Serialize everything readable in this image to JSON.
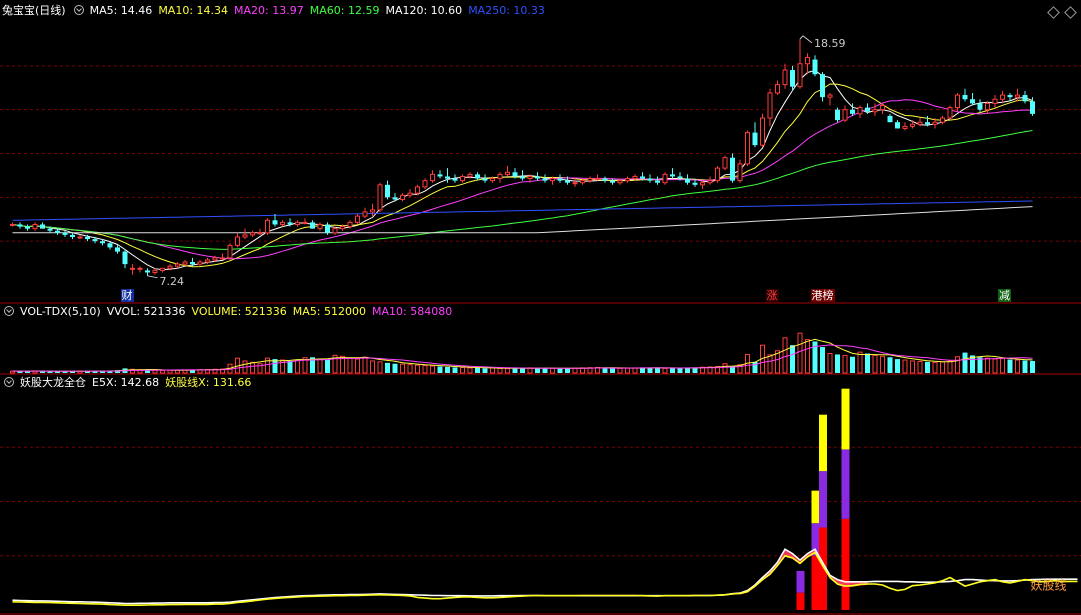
{
  "main_header": {
    "title": "兔宝宝(日线)",
    "ma_labels": [
      {
        "text": "MA5: 14.46",
        "color": "#ffffff"
      },
      {
        "text": "MA10: 14.34",
        "color": "#ffff40"
      },
      {
        "text": "MA20: 13.97",
        "color": "#ff40ff"
      },
      {
        "text": "MA60: 12.59",
        "color": "#40ff40"
      },
      {
        "text": "MA120: 10.60",
        "color": "#ffffff"
      },
      {
        "text": "MA250: 10.33",
        "color": "#3050ff"
      }
    ]
  },
  "vol_header": {
    "title": "VOL-TDX(5,10)",
    "labels": [
      {
        "text": "VVOL: 521336",
        "color": "#ffffff"
      },
      {
        "text": "VOLUME: 521336",
        "color": "#ffff40"
      },
      {
        "text": "MA5: 512000",
        "color": "#ffff40"
      },
      {
        "text": "MA10: 584080",
        "color": "#ff40ff"
      }
    ]
  },
  "ind_header": {
    "title": "妖股大龙全仓",
    "labels": [
      {
        "text": "E5X: 142.68",
        "color": "#ffffff"
      },
      {
        "text": "妖股线X: 131.66",
        "color": "#ffff40"
      }
    ]
  },
  "annotations": {
    "high": "18.59",
    "low": "7.24",
    "ind_line_label": "妖股线"
  },
  "events": [
    {
      "text": "财",
      "color": "#ffffff",
      "bg": "#1030a0",
      "bar": 15
    },
    {
      "text": "涨",
      "color": "#ff4040",
      "bg": "#300000",
      "bar": 101
    },
    {
      "text": "港榜",
      "color": "#ffffff",
      "bg": "#700000",
      "bar": 107
    },
    {
      "text": "减",
      "color": "#ffffff",
      "bg": "#106010",
      "bar": 132
    }
  ],
  "chart_data": {
    "type": "candlestick",
    "price_range": [
      6.8,
      19.4
    ],
    "volume_max": 1100000,
    "indicator_range": [
      0,
      1000
    ],
    "candles": [
      [
        9.7,
        9.8,
        9.6,
        9.7
      ],
      [
        9.7,
        9.8,
        9.5,
        9.6
      ],
      [
        9.6,
        9.7,
        9.4,
        9.5
      ],
      [
        9.5,
        9.8,
        9.4,
        9.7
      ],
      [
        9.7,
        9.8,
        9.5,
        9.5
      ],
      [
        9.5,
        9.6,
        9.3,
        9.4
      ],
      [
        9.4,
        9.5,
        9.2,
        9.3
      ],
      [
        9.3,
        9.4,
        9.1,
        9.2
      ],
      [
        9.2,
        9.3,
        9.0,
        9.1
      ],
      [
        9.1,
        9.2,
        9.0,
        9.1
      ],
      [
        9.1,
        9.2,
        8.9,
        9.0
      ],
      [
        9.0,
        9.1,
        8.8,
        8.9
      ],
      [
        8.9,
        9.0,
        8.7,
        8.8
      ],
      [
        8.8,
        8.9,
        8.5,
        8.6
      ],
      [
        8.6,
        8.7,
        8.3,
        8.4
      ],
      [
        8.4,
        8.5,
        7.6,
        7.8
      ],
      [
        7.6,
        7.8,
        7.3,
        7.6
      ],
      [
        7.6,
        7.7,
        7.4,
        7.6
      ],
      [
        7.5,
        7.6,
        7.24,
        7.4
      ],
      [
        7.4,
        7.6,
        7.3,
        7.5
      ],
      [
        7.5,
        7.6,
        7.4,
        7.6
      ],
      [
        7.6,
        7.8,
        7.5,
        7.7
      ],
      [
        7.7,
        7.9,
        7.6,
        7.8
      ],
      [
        7.8,
        8.0,
        7.7,
        7.9
      ],
      [
        7.9,
        8.1,
        7.7,
        7.8
      ],
      [
        7.8,
        8.0,
        7.7,
        7.9
      ],
      [
        7.9,
        8.1,
        7.8,
        8.0
      ],
      [
        8.0,
        8.2,
        7.9,
        8.1
      ],
      [
        8.1,
        8.3,
        8.0,
        8.1
      ],
      [
        8.1,
        8.8,
        8.0,
        8.7
      ],
      [
        8.7,
        9.3,
        8.6,
        9.1
      ],
      [
        9.1,
        9.5,
        9.0,
        9.2
      ],
      [
        9.2,
        9.4,
        9.1,
        9.3
      ],
      [
        9.3,
        9.5,
        9.2,
        9.3
      ],
      [
        9.3,
        10.0,
        9.2,
        9.9
      ],
      [
        9.9,
        10.2,
        9.6,
        9.7
      ],
      [
        9.7,
        9.9,
        9.6,
        9.8
      ],
      [
        9.8,
        10.0,
        9.6,
        9.7
      ],
      [
        9.7,
        9.9,
        9.6,
        9.8
      ],
      [
        9.8,
        10.0,
        9.7,
        9.8
      ],
      [
        9.8,
        9.9,
        9.5,
        9.5
      ],
      [
        9.5,
        9.8,
        9.4,
        9.7
      ],
      [
        9.7,
        9.8,
        9.2,
        9.3
      ],
      [
        9.3,
        9.6,
        9.2,
        9.5
      ],
      [
        9.5,
        9.7,
        9.4,
        9.6
      ],
      [
        9.6,
        9.9,
        9.5,
        9.8
      ],
      [
        9.8,
        10.2,
        9.7,
        10.1
      ],
      [
        10.1,
        10.5,
        10.0,
        10.3
      ],
      [
        10.3,
        10.7,
        10.1,
        10.4
      ],
      [
        10.4,
        11.7,
        10.3,
        11.6
      ],
      [
        11.6,
        11.8,
        10.9,
        11.0
      ],
      [
        11.0,
        11.2,
        10.8,
        10.9
      ],
      [
        10.9,
        11.2,
        10.8,
        11.1
      ],
      [
        11.1,
        11.4,
        11.0,
        11.2
      ],
      [
        11.2,
        11.6,
        11.1,
        11.5
      ],
      [
        11.5,
        11.9,
        11.4,
        11.8
      ],
      [
        11.8,
        12.3,
        11.7,
        12.1
      ],
      [
        12.1,
        12.3,
        11.9,
        12.0
      ],
      [
        12.0,
        12.4,
        11.7,
        11.9
      ],
      [
        11.9,
        12.1,
        11.7,
        11.8
      ],
      [
        11.8,
        12.1,
        11.7,
        12.0
      ],
      [
        12.0,
        12.2,
        11.9,
        12.1
      ],
      [
        12.1,
        12.2,
        11.8,
        11.9
      ],
      [
        11.9,
        12.1,
        11.7,
        11.8
      ],
      [
        11.8,
        12.0,
        11.7,
        11.9
      ],
      [
        11.9,
        12.2,
        11.7,
        12.1
      ],
      [
        12.1,
        12.5,
        12.0,
        12.2
      ],
      [
        12.2,
        12.4,
        11.9,
        12.0
      ],
      [
        12.0,
        12.3,
        11.8,
        11.9
      ],
      [
        11.9,
        12.1,
        11.7,
        12.0
      ],
      [
        12.0,
        12.2,
        11.8,
        11.9
      ],
      [
        11.9,
        12.1,
        11.7,
        11.8
      ],
      [
        11.8,
        12.0,
        11.6,
        11.9
      ],
      [
        11.9,
        12.1,
        11.7,
        11.8
      ],
      [
        11.8,
        12.0,
        11.6,
        11.7
      ],
      [
        11.7,
        11.9,
        11.5,
        11.7
      ],
      [
        11.7,
        11.9,
        11.6,
        11.8
      ],
      [
        11.8,
        12.0,
        11.7,
        11.9
      ],
      [
        11.9,
        12.1,
        11.8,
        11.9
      ],
      [
        11.9,
        12.0,
        11.7,
        11.8
      ],
      [
        11.8,
        11.9,
        11.6,
        11.7
      ],
      [
        11.7,
        11.9,
        11.6,
        11.8
      ],
      [
        11.8,
        12.0,
        11.7,
        11.9
      ],
      [
        11.9,
        12.1,
        11.8,
        12.0
      ],
      [
        12.0,
        12.2,
        11.8,
        11.9
      ],
      [
        11.9,
        12.1,
        11.7,
        11.8
      ],
      [
        11.8,
        12.0,
        11.6,
        11.7
      ],
      [
        11.7,
        12.2,
        11.6,
        12.1
      ],
      [
        12.1,
        12.4,
        11.9,
        12.0
      ],
      [
        12.0,
        12.2,
        11.8,
        11.9
      ],
      [
        11.9,
        12.1,
        11.6,
        11.7
      ],
      [
        11.7,
        11.9,
        11.5,
        11.6
      ],
      [
        11.6,
        11.8,
        11.4,
        11.7
      ],
      [
        11.7,
        12.0,
        11.6,
        11.8
      ],
      [
        11.8,
        12.5,
        11.7,
        12.4
      ],
      [
        12.4,
        13.0,
        12.3,
        12.9
      ],
      [
        12.9,
        13.1,
        11.7,
        11.8
      ],
      [
        11.8,
        12.8,
        11.7,
        12.6
      ],
      [
        12.6,
        14.2,
        12.5,
        14.1
      ],
      [
        14.1,
        14.6,
        13.4,
        13.5
      ],
      [
        13.5,
        15.0,
        13.4,
        14.8
      ],
      [
        14.8,
        16.2,
        14.4,
        16.0
      ],
      [
        16.0,
        16.6,
        15.9,
        16.4
      ],
      [
        16.4,
        17.4,
        16.2,
        17.1
      ],
      [
        17.1,
        17.3,
        16.1,
        16.3
      ],
      [
        16.3,
        18.59,
        16.2,
        17.4
      ],
      [
        17.4,
        17.9,
        16.9,
        17.7
      ],
      [
        17.6,
        17.8,
        16.8,
        16.9
      ],
      [
        16.9,
        17.0,
        15.6,
        15.8
      ],
      [
        15.8,
        16.0,
        15.4,
        15.9
      ],
      [
        15.2,
        15.3,
        14.6,
        14.7
      ],
      [
        14.7,
        15.4,
        14.6,
        15.2
      ],
      [
        15.2,
        15.5,
        14.9,
        15.0
      ],
      [
        15.0,
        15.4,
        14.8,
        15.3
      ],
      [
        15.3,
        15.5,
        15.0,
        15.1
      ],
      [
        15.1,
        15.5,
        14.9,
        15.2
      ],
      [
        15.2,
        15.5,
        15.0,
        15.4
      ],
      [
        14.9,
        15.0,
        14.6,
        14.6
      ],
      [
        14.6,
        14.7,
        14.3,
        14.3
      ],
      [
        14.3,
        14.6,
        14.2,
        14.4
      ],
      [
        14.4,
        14.7,
        14.3,
        14.5
      ],
      [
        14.5,
        14.8,
        14.4,
        14.6
      ],
      [
        14.6,
        14.9,
        14.4,
        14.5
      ],
      [
        14.5,
        14.8,
        14.3,
        14.6
      ],
      [
        14.6,
        14.9,
        14.5,
        14.8
      ],
      [
        14.8,
        15.4,
        14.7,
        15.3
      ],
      [
        15.3,
        16.0,
        15.1,
        15.9
      ],
      [
        15.9,
        16.2,
        15.6,
        15.7
      ],
      [
        15.7,
        16.0,
        15.4,
        15.5
      ],
      [
        15.5,
        15.7,
        15.1,
        15.2
      ],
      [
        15.2,
        15.6,
        15.0,
        15.5
      ],
      [
        15.5,
        15.9,
        15.3,
        15.7
      ],
      [
        15.7,
        16.1,
        15.5,
        15.9
      ],
      [
        15.9,
        16.0,
        15.6,
        15.8
      ],
      [
        15.8,
        16.2,
        15.6,
        15.9
      ],
      [
        15.9,
        16.1,
        15.5,
        15.6
      ],
      [
        15.6,
        15.8,
        14.9,
        15.0
      ]
    ],
    "volumes": [
      40000,
      42000,
      38000,
      45000,
      40000,
      38000,
      36000,
      40000,
      42000,
      39000,
      41000,
      43000,
      45000,
      50000,
      60000,
      100000,
      80000,
      70000,
      65000,
      60000,
      55000,
      60000,
      62000,
      65000,
      70000,
      72000,
      75000,
      80000,
      85000,
      190000,
      320000,
      260000,
      230000,
      200000,
      320000,
      300000,
      280000,
      260000,
      280000,
      330000,
      340000,
      300000,
      280000,
      380000,
      360000,
      320000,
      300000,
      340000,
      260000,
      240000,
      220000,
      200000,
      190000,
      180000,
      170000,
      160000,
      150000,
      140000,
      130000,
      120000,
      120000,
      110000,
      110000,
      100000,
      110000,
      100000,
      95000,
      100000,
      105000,
      110000,
      110000,
      105000,
      100000,
      95000,
      100000,
      105000,
      110000,
      115000,
      120000,
      110000,
      105000,
      100000,
      105000,
      110000,
      120000,
      115000,
      110000,
      100000,
      105000,
      110000,
      115000,
      120000,
      125000,
      130000,
      140000,
      200000,
      150000,
      180000,
      400000,
      240000,
      600000,
      390000,
      480000,
      760000,
      600000,
      860000,
      720000,
      680000,
      560000,
      420000,
      400000,
      380000,
      350000,
      450000,
      420000,
      380000,
      360000,
      340000,
      300000,
      280000,
      260000,
      250000,
      240000,
      230000,
      240000,
      260000,
      350000,
      440000,
      380000,
      340000,
      320000,
      300000,
      310000,
      290000,
      280000,
      270000,
      260000
    ],
    "indicator_spikes": [
      {
        "bar": 105,
        "red": 80,
        "purple": 100
      },
      {
        "bar": 107,
        "red": 250,
        "purple": 150,
        "yellow": 150
      },
      {
        "bar": 108,
        "red": 380,
        "purple": 260,
        "yellow": 260
      },
      {
        "bar": 111,
        "red": 420,
        "purple": 320,
        "yellow": 280
      }
    ],
    "indicator_lines": {
      "e5x": [
        45,
        44,
        43,
        42,
        42,
        41,
        40,
        39,
        38,
        38,
        37,
        36,
        35,
        33,
        32,
        30,
        30,
        31,
        31,
        32,
        32,
        33,
        33,
        33,
        33,
        33,
        33,
        34,
        34,
        36,
        40,
        44,
        47,
        50,
        54,
        57,
        60,
        62,
        64,
        66,
        67,
        68,
        69,
        70,
        70,
        71,
        71,
        72,
        73,
        74,
        73,
        72,
        71,
        70,
        69,
        68,
        67,
        67,
        66,
        66,
        66,
        65,
        65,
        65,
        65,
        66,
        66,
        66,
        67,
        67,
        67,
        66,
        66,
        66,
        66,
        66,
        66,
        66,
        66,
        66,
        66,
        66,
        66,
        66,
        66,
        66,
        66,
        66,
        66,
        66,
        66,
        67,
        67,
        67,
        68,
        70,
        75,
        78,
        90,
        115,
        150,
        180,
        220,
        280,
        260,
        230,
        260,
        280,
        220,
        160,
        140,
        130,
        130,
        130,
        130,
        132,
        132,
        132,
        132,
        130,
        130,
        128,
        128,
        128,
        130,
        132,
        135,
        140,
        140,
        138,
        136,
        135,
        134,
        134,
        135,
        138,
        140,
        141,
        142,
        142,
        142,
        142,
        142
      ],
      "yao": [
        38,
        37,
        36,
        35,
        35,
        34,
        33,
        32,
        31,
        30,
        29,
        28,
        27,
        25,
        24,
        22,
        22,
        22,
        23,
        24,
        24,
        25,
        25,
        26,
        26,
        26,
        26,
        27,
        27,
        30,
        35,
        38,
        42,
        46,
        50,
        53,
        56,
        58,
        60,
        62,
        63,
        64,
        65,
        66,
        66,
        67,
        67,
        68,
        69,
        70,
        69,
        68,
        67,
        65,
        58,
        55,
        52,
        52,
        55,
        58,
        60,
        60,
        58,
        56,
        56,
        58,
        60,
        62,
        64,
        66,
        67,
        66,
        66,
        66,
        66,
        66,
        67,
        67,
        67,
        67,
        67,
        67,
        67,
        67,
        66,
        65,
        64,
        66,
        66,
        66,
        66,
        67,
        67,
        67,
        68,
        70,
        74,
        76,
        85,
        110,
        140,
        165,
        205,
        250,
        240,
        215,
        245,
        265,
        205,
        150,
        120,
        110,
        112,
        118,
        120,
        120,
        115,
        100,
        90,
        95,
        112,
        115,
        120,
        125,
        135,
        150,
        130,
        110,
        120,
        130,
        135,
        140,
        130,
        125,
        132,
        140,
        135,
        130,
        132,
        135,
        132,
        132,
        132
      ]
    }
  }
}
